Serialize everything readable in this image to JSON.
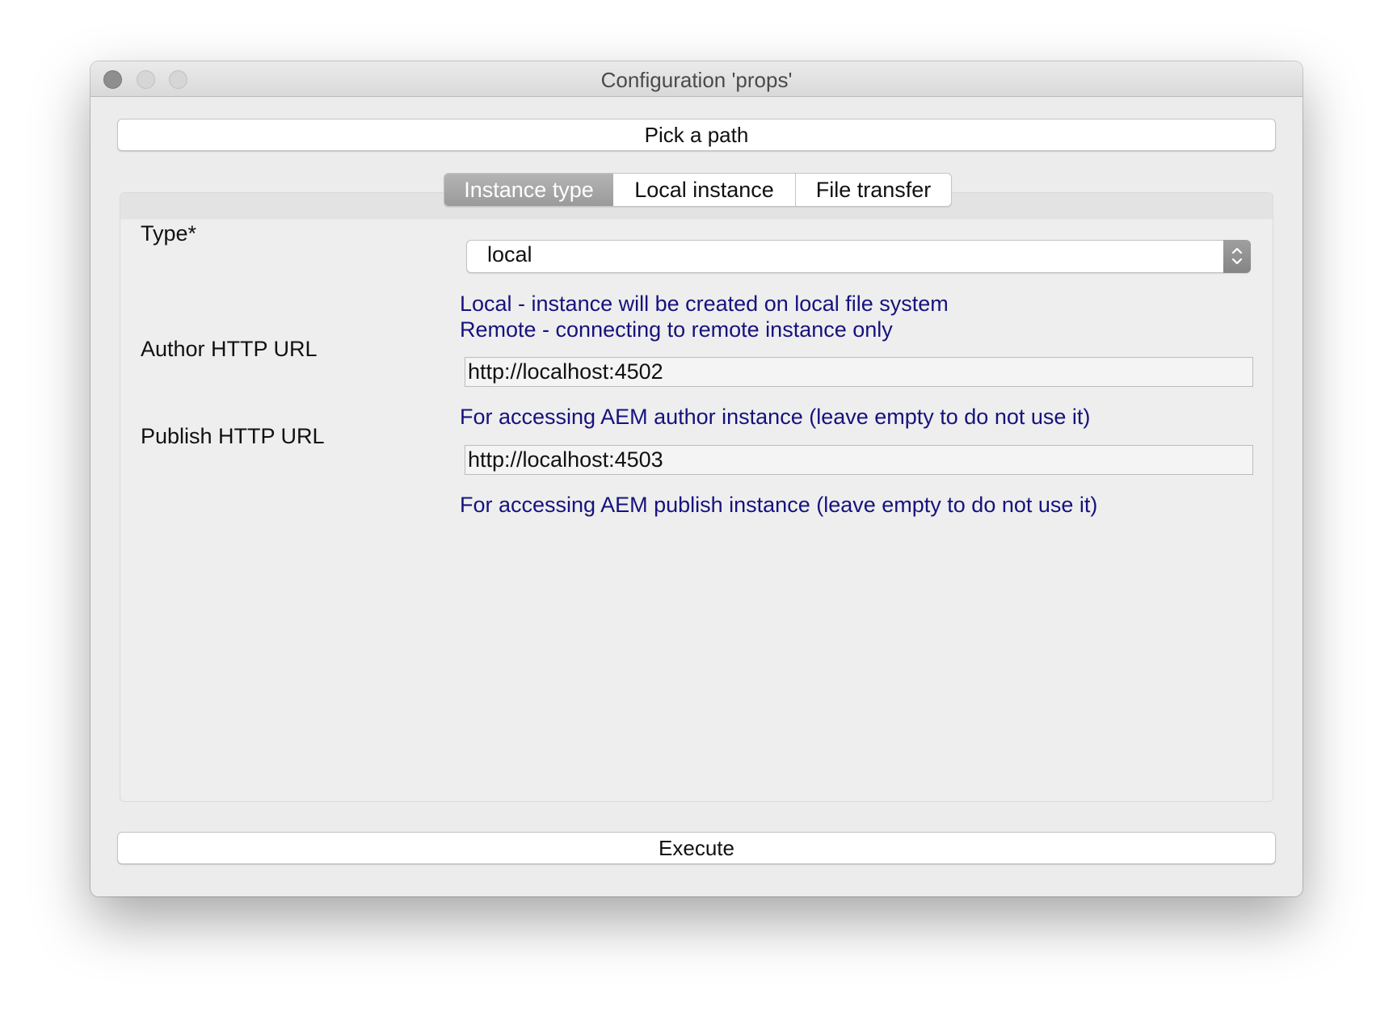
{
  "window": {
    "title": "Configuration 'props'"
  },
  "toolbar": {
    "pick_path_label": "Pick a path",
    "execute_label": "Execute"
  },
  "tabs": [
    {
      "label": "Instance type",
      "selected": true
    },
    {
      "label": "Local instance",
      "selected": false
    },
    {
      "label": "File transfer",
      "selected": false
    }
  ],
  "form": {
    "type": {
      "label": "Type*",
      "value": "local",
      "hint_line1": "Local - instance will be created on local file system",
      "hint_line2": "Remote - connecting to remote instance only"
    },
    "author_url": {
      "label": "Author HTTP URL",
      "value": "http://localhost:4502",
      "hint": "For accessing AEM author instance (leave empty to do not use it)"
    },
    "publish_url": {
      "label": "Publish HTTP URL",
      "value": "http://localhost:4503",
      "hint": "For accessing AEM publish instance (leave empty to do not use it)"
    }
  },
  "colors": {
    "hint_text": "#16127e",
    "selected_tab": "#9a9a9a",
    "window_bg": "#ececec"
  },
  "icons": [
    "close-window-icon",
    "minimize-window-icon",
    "maximize-window-icon",
    "select-arrows-icon"
  ]
}
